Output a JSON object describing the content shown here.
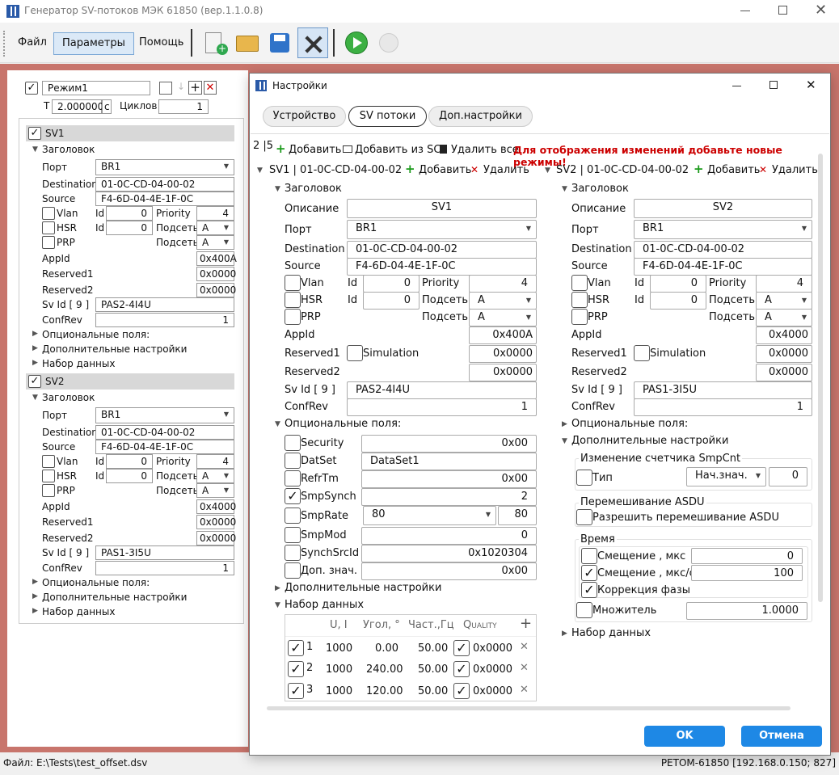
{
  "app": {
    "title": "Генератор SV-потоков МЭК 61850 (вер.1.1.0.8)"
  },
  "menu": {
    "file": "Файл",
    "params": "Параметры",
    "help": "Помощь"
  },
  "status": {
    "file": "Файл:  E:\\Tests\\test_offset.dsv",
    "device": "РЕТОМ-61850 [192.168.0.150; 827]"
  },
  "left": {
    "mode": "Режим1",
    "t_label": "T",
    "t_value": "2.000000",
    "t_unit": "с",
    "cycles_label": "Циклов",
    "cycles_value": "1",
    "labels": {
      "header": "Заголовок",
      "port": "Порт",
      "destination": "Destination",
      "source": "Source",
      "vlan": "Vlan",
      "id": "Id",
      "priority": "Priority",
      "hsr": "HSR",
      "subnet": "Подсеть",
      "prp": "PRP",
      "appid": "AppId",
      "reserved1": "Reserved1",
      "reserved2": "Reserved2",
      "svid": "Sv Id [ 9 ]",
      "confrev": "ConfRev",
      "optional": "Опциональные поля:",
      "extra": "Дополнительные настройки",
      "dataset": "Набор данных"
    },
    "sv1": {
      "name": "SV1",
      "port": "BR1",
      "destination": "01-0C-CD-04-00-02",
      "source": "F4-6D-04-4E-1F-0C",
      "vlan_id": "0",
      "priority": "4",
      "hsr_id": "0",
      "subnet_hsr": "A",
      "subnet_prp": "A",
      "appid": "0x400A",
      "reserved1": "0x0000",
      "reserved2": "0x0000",
      "svid": "PAS2-4I4U",
      "confrev": "1"
    },
    "sv2": {
      "name": "SV2",
      "port": "BR1",
      "destination": "01-0C-CD-04-00-02",
      "source": "F4-6D-04-4E-1F-0C",
      "vlan_id": "0",
      "priority": "4",
      "hsr_id": "0",
      "subnet_hsr": "A",
      "subnet_prp": "A",
      "appid": "0x4000",
      "reserved1": "0x0000",
      "reserved2": "0x0000",
      "svid": "PAS1-3I5U",
      "confrev": "1"
    }
  },
  "dialog": {
    "title": "Настройки",
    "tabs": [
      "Устройство",
      "SV потоки",
      "Доп.настройки"
    ],
    "counter": "2 |5",
    "add": "Добавить",
    "add_scl": "Добавить из SCL",
    "delete_all": "Удалить все",
    "warning": "Для отображения изменений добавьте новые режимы!",
    "delete": "Удалить",
    "labels": {
      "header": "Заголовок",
      "description": "Описание",
      "port": "Порт",
      "destination": "Destination",
      "source": "Source",
      "vlan": "Vlan",
      "id": "Id",
      "priority": "Priority",
      "hsr": "HSR",
      "subnet": "Подсеть",
      "prp": "PRP",
      "appid": "AppId",
      "reserved1": "Reserved1",
      "reserved2": "Reserved2",
      "simulation": "Simulation",
      "svid": "Sv Id [ 9 ]",
      "confrev": "ConfRev",
      "optional": "Опциональные поля:",
      "extra": "Дополнительные настройки",
      "dataset": "Набор данных"
    },
    "sv1": {
      "title": "SV1 | 01-0C-CD-04-00-02",
      "description": "SV1",
      "port": "BR1",
      "destination": "01-0C-CD-04-00-02",
      "source": "F4-6D-04-4E-1F-0C",
      "vlan_id": "0",
      "priority": "4",
      "hsr_id": "0",
      "subnet_hsr": "A",
      "subnet_prp": "A",
      "appid": "0x400A",
      "reserved1": "0x0000",
      "reserved2": "0x0000",
      "svid": "PAS2-4I4U",
      "confrev": "1",
      "opt": {
        "security": "Security",
        "security_v": "0x00",
        "dataset": "DatSet",
        "dataset_v": "DataSet1",
        "refrtm": "RefrTm",
        "refrtm_v": "0x00",
        "smpsynch": "SmpSynch",
        "smpsynch_v": "2",
        "smprate": "SmpRate",
        "smprate_sel": "80",
        "smprate_v": "80",
        "smpmod": "SmpMod",
        "smpmod_v": "0",
        "synchsrcid": "SynchSrcId",
        "synchsrcid_v": "0x1020304",
        "extra": "Доп. знач.",
        "extra_v": "0x00"
      },
      "table": {
        "headers": [
          "U, I",
          "Угол, °",
          "Част.,Гц",
          "Quality"
        ],
        "rows": [
          {
            "n": "1",
            "u": "1000",
            "angle": "0.00",
            "freq": "50.00",
            "q": "0x0000"
          },
          {
            "n": "2",
            "u": "1000",
            "angle": "240.00",
            "freq": "50.00",
            "q": "0x0000"
          },
          {
            "n": "3",
            "u": "1000",
            "angle": "120.00",
            "freq": "50.00",
            "q": "0x0000"
          }
        ]
      }
    },
    "sv2": {
      "title": "SV2 | 01-0C-CD-04-00-02",
      "description": "SV2",
      "port": "BR1",
      "destination": "01-0C-CD-04-00-02",
      "source": "F4-6D-04-4E-1F-0C",
      "vlan_id": "0",
      "priority": "4",
      "hsr_id": "0",
      "subnet_hsr": "A",
      "subnet_prp": "A",
      "appid": "0x4000",
      "reserved1": "0x0000",
      "reserved2": "0x0000",
      "svid": "PAS1-3I5U",
      "confrev": "1",
      "smpcnt": {
        "title": "Изменение счетчика SmpCnt",
        "type": "Тип",
        "select": "Нач.знач.",
        "value": "0"
      },
      "asdu": {
        "title": "Перемешивание ASDU",
        "allow": "Разрешить перемешивание ASDU"
      },
      "time": {
        "title": "Время",
        "offset_us": "Смещение , мкс",
        "offset_us_v": "0",
        "offset_rate": "Смещение , мкс/с",
        "offset_rate_v": "100",
        "phase": "Коррекция фазы"
      },
      "mult": "Множитель",
      "mult_v": "1.0000"
    },
    "ok": "OK",
    "cancel": "Отмена"
  }
}
